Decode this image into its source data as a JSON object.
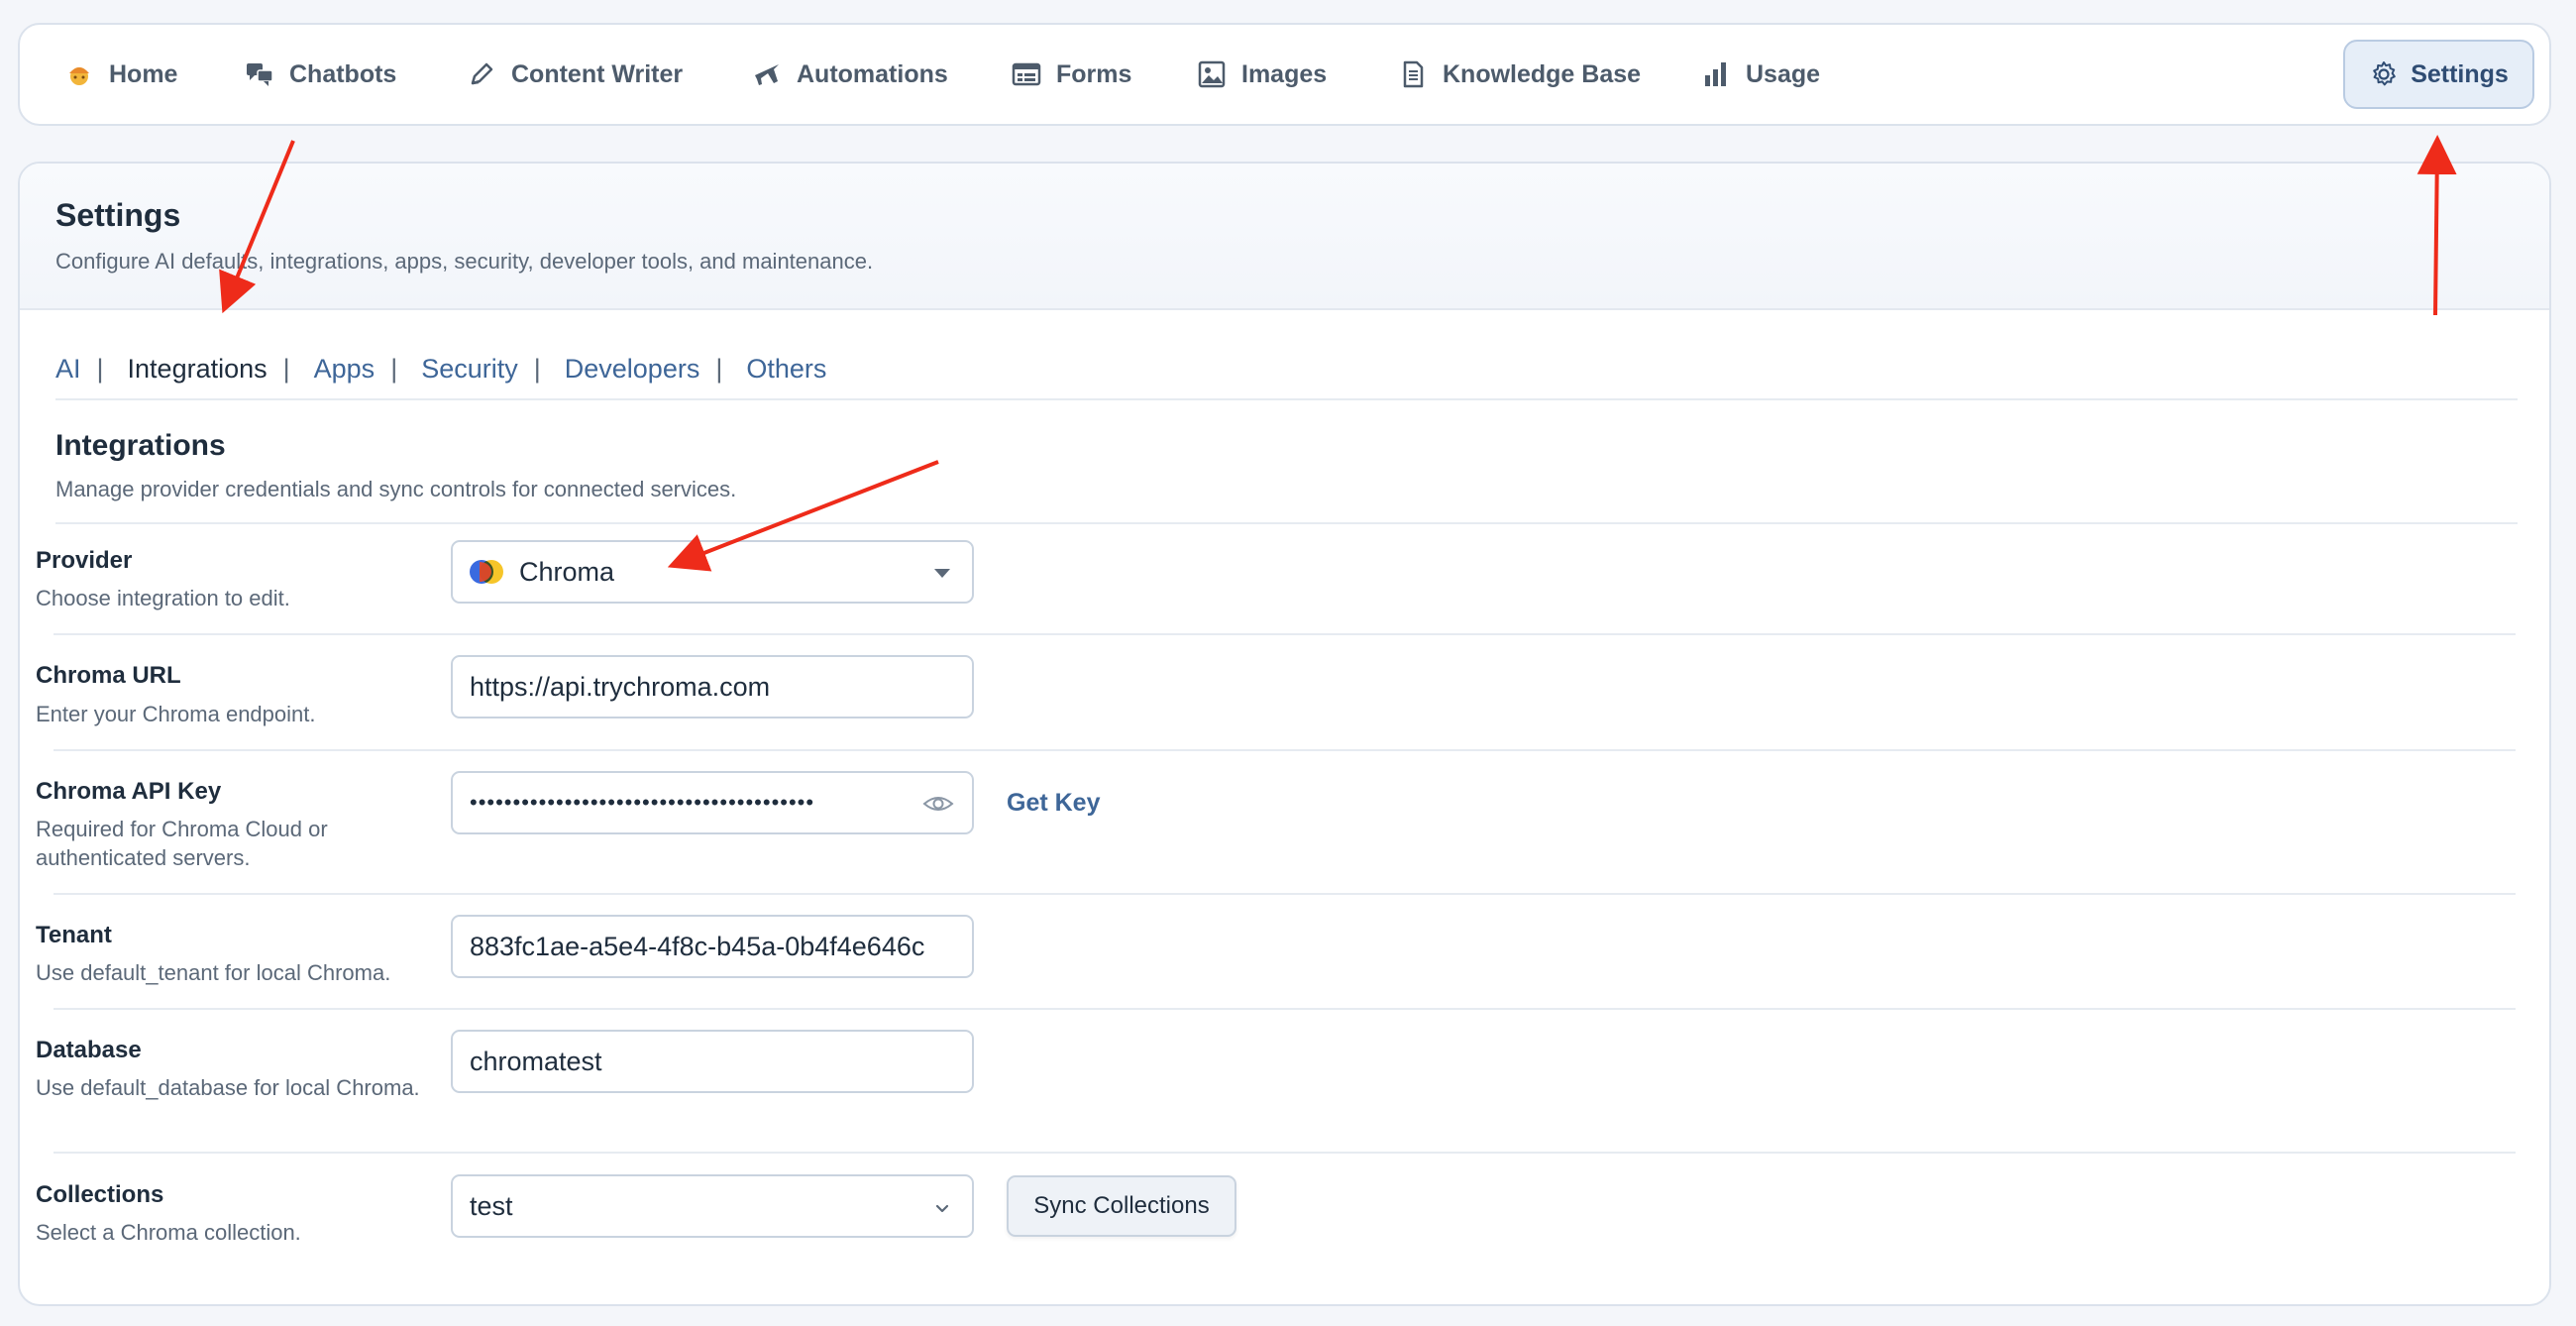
{
  "nav": {
    "items": [
      {
        "label": "Home",
        "icon": "home-emoji-icon"
      },
      {
        "label": "Chatbots",
        "icon": "chat-bubbles-icon"
      },
      {
        "label": "Content Writer",
        "icon": "pencil-icon"
      },
      {
        "label": "Automations",
        "icon": "plane-icon"
      },
      {
        "label": "Forms",
        "icon": "form-icon"
      },
      {
        "label": "Images",
        "icon": "image-icon"
      },
      {
        "label": "Knowledge Base",
        "icon": "document-icon"
      },
      {
        "label": "Usage",
        "icon": "bar-chart-icon"
      }
    ],
    "settings_label": "Settings",
    "settings_icon": "gear-icon"
  },
  "page": {
    "title": "Settings",
    "subtitle": "Configure AI defaults, integrations, apps, security, developer tools, and maintenance."
  },
  "tabs": [
    {
      "label": "AI",
      "active": false
    },
    {
      "label": "Integrations",
      "active": true
    },
    {
      "label": "Apps",
      "active": false
    },
    {
      "label": "Security",
      "active": false
    },
    {
      "label": "Developers",
      "active": false
    },
    {
      "label": "Others",
      "active": false
    }
  ],
  "tab_separator": "|",
  "section": {
    "title": "Integrations",
    "subtitle": "Manage provider credentials and sync controls for connected services."
  },
  "form": {
    "provider": {
      "label": "Provider",
      "help": "Choose integration to edit.",
      "value": "Chroma"
    },
    "url": {
      "label": "Chroma URL",
      "help": "Enter your Chroma endpoint.",
      "value": "https://api.trychroma.com"
    },
    "api_key": {
      "label": "Chroma API Key",
      "help": "Required for Chroma Cloud or authenticated servers.",
      "value": "••••••••••••••••••••••••••••••••••••••••",
      "get_key_label": "Get Key"
    },
    "tenant": {
      "label": "Tenant",
      "help": "Use default_tenant for local Chroma.",
      "value": "883fc1ae-a5e4-4f8c-b45a-0b4f4e646c"
    },
    "database": {
      "label": "Database",
      "help": "Use default_database for local Chroma.",
      "value": "chromatest"
    },
    "collections": {
      "label": "Collections",
      "help": "Select a Chroma collection.",
      "value": "test",
      "sync_label": "Sync Collections"
    }
  },
  "colors": {
    "accent": "#3e6698",
    "annotation_arrow": "#ee2b1a",
    "active_button_bg": "#e6eef8"
  }
}
